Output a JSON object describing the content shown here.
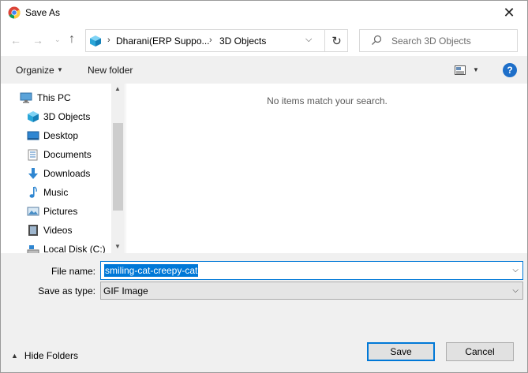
{
  "window": {
    "title": "Save As",
    "close_glyph": "✕"
  },
  "nav": {
    "back_glyph": "←",
    "forward_glyph": "→",
    "recent_glyph": "⌄",
    "up_glyph": "↑"
  },
  "address": {
    "sep": "›",
    "crumbs": [
      "Dharani(ERP Suppo...",
      "3D Objects"
    ],
    "dropdown_glyph": "⌵",
    "refresh_glyph": "↻"
  },
  "search": {
    "placeholder": "Search 3D Objects"
  },
  "toolbar": {
    "organize_label": "Organize",
    "caret": "▼",
    "new_folder_label": "New folder",
    "help_label": "?"
  },
  "sidebar": {
    "items": [
      {
        "label": "This PC",
        "icon": "computer-icon"
      },
      {
        "label": "3D Objects",
        "icon": "cube-icon"
      },
      {
        "label": "Desktop",
        "icon": "desktop-icon"
      },
      {
        "label": "Documents",
        "icon": "documents-icon"
      },
      {
        "label": "Downloads",
        "icon": "download-icon"
      },
      {
        "label": "Music",
        "icon": "music-icon"
      },
      {
        "label": "Pictures",
        "icon": "pictures-icon"
      },
      {
        "label": "Videos",
        "icon": "videos-icon"
      },
      {
        "label": "Local Disk (C:)",
        "icon": "disk-icon"
      }
    ],
    "scroll_up": "▲",
    "scroll_down": "▼"
  },
  "content": {
    "empty_message": "No items match your search."
  },
  "form": {
    "filename_label": "File name:",
    "filename_value": "smiling-cat-creepy-cat",
    "savetype_label": "Save as type:",
    "savetype_value": "GIF Image",
    "dropdown_glyph": "⌵"
  },
  "footer": {
    "hide_folders_caret": "▲",
    "hide_folders_label": "Hide Folders",
    "save_label": "Save",
    "cancel_label": "Cancel"
  },
  "colors": {
    "accent": "#0078d7",
    "help": "#1e6fc9",
    "cube": "#2aa6d8"
  }
}
